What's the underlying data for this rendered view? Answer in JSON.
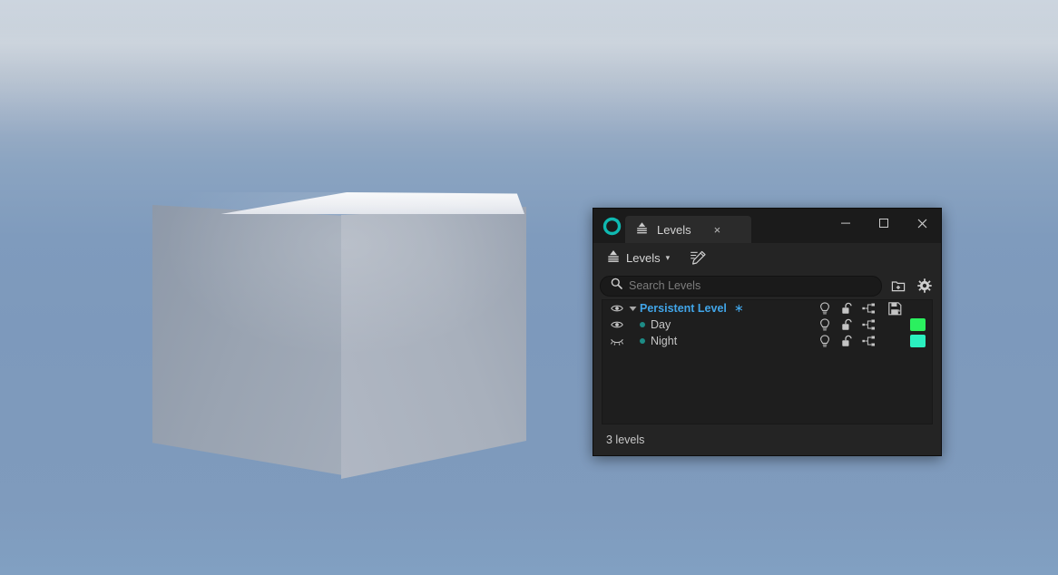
{
  "scene": {
    "name": "3d-viewport",
    "background_description": "sky gradient with haze band",
    "sky_top_color": "#bcc5d0",
    "sky_bottom_color": "#7f9bbd",
    "object": "cube",
    "cube_top_color": "#f2f4f7",
    "cube_left_color": "#99a3b1",
    "cube_right_color": "#a8b0bc"
  },
  "window": {
    "logo_icon": "unreal-ring-logo-icon",
    "logo_color": "#0fb9b1",
    "tab": {
      "icon": "layers-icon",
      "label": "Levels",
      "close_label": "×"
    },
    "controls": {
      "minimize_label": "—",
      "maximize_label": "□",
      "close_label": "✕"
    }
  },
  "toolbar": {
    "levels_menu_label": "Levels",
    "levels_menu_icon": "layers-icon",
    "chevron": "▾",
    "edit_icon": "pen-edit-icon"
  },
  "search": {
    "icon": "search-icon",
    "placeholder": "Search Levels",
    "value": "",
    "new_level_icon": "folder-add-icon",
    "settings_icon": "gear-icon"
  },
  "levels": {
    "columns": [
      "visibility",
      "expand",
      "name",
      "lighting",
      "lock",
      "streaming",
      "save",
      "color"
    ],
    "rows": [
      {
        "name": "Persistent Level",
        "modified_marker": "∗",
        "is_persistent": true,
        "visible": true,
        "eye_icon": "eye-open-icon",
        "expander_icon": "triangle-down-icon",
        "expanded": true,
        "lightbulb_icon": "lightbulb-icon",
        "lock_icon": "padlock-open-icon",
        "streaming_icon": "hierarchy-icon",
        "save_icon": "save-disk-modified-icon",
        "has_save_icon": true,
        "color": null,
        "name_color": "#41a5e8"
      },
      {
        "name": "Day",
        "modified_marker": "",
        "is_persistent": false,
        "visible": true,
        "eye_icon": "eye-open-icon",
        "expander_icon": null,
        "dot_color": "#1d8c86",
        "lightbulb_icon": "lightbulb-icon",
        "lock_icon": "padlock-open-icon",
        "streaming_icon": "hierarchy-icon",
        "save_icon": null,
        "has_save_icon": false,
        "color": "#2bf05f",
        "name_color": "#c6c6c6"
      },
      {
        "name": "Night",
        "modified_marker": "",
        "is_persistent": false,
        "visible": false,
        "eye_icon": "eye-closed-icon",
        "expander_icon": null,
        "dot_color": "#1d8c86",
        "lightbulb_icon": "lightbulb-icon",
        "lock_icon": "padlock-open-icon",
        "streaming_icon": "hierarchy-icon",
        "save_icon": null,
        "has_save_icon": false,
        "color": "#2bf0c0",
        "name_color": "#c6c6c6"
      }
    ]
  },
  "status": {
    "text": "3 levels"
  }
}
